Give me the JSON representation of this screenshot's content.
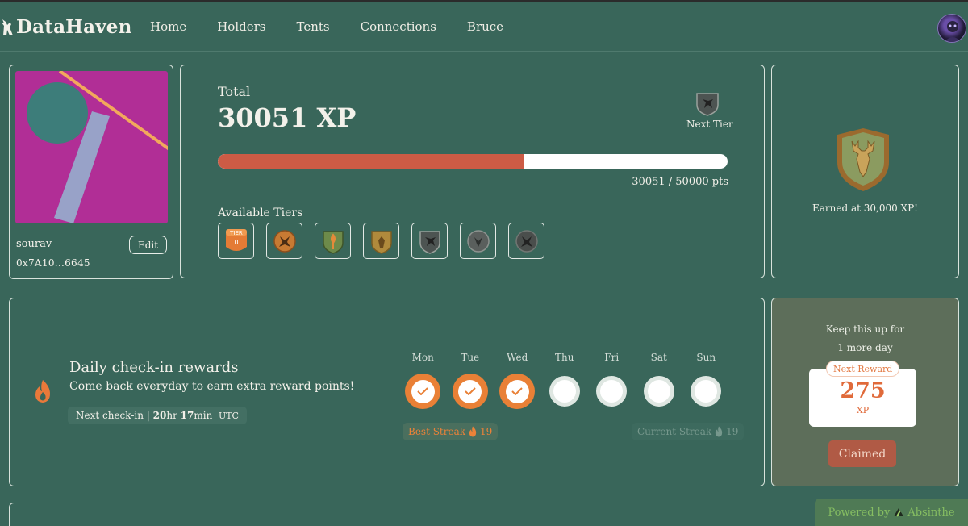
{
  "app": {
    "name": "DataHaven"
  },
  "nav": {
    "items": [
      "Home",
      "Holders",
      "Tents",
      "Connections",
      "Bruce"
    ]
  },
  "profile": {
    "username": "sourav",
    "address": "0x7A10...6645",
    "edit_label": "Edit"
  },
  "xp": {
    "total_label": "Total",
    "total_value": "30051 XP",
    "next_tier_label": "Next Tier",
    "progress_text": "30051 / 50000 pts",
    "progress_fraction": 0.601,
    "tiers_label": "Available Tiers",
    "tier0_badge_line1": "TIER",
    "tier0_badge_line2": "0"
  },
  "earned": {
    "text": "Earned at 30,000 XP!"
  },
  "checkin": {
    "title": "Daily check-in rewards",
    "subtitle": "Come back everyday to earn extra reward points!",
    "next_label": "Next check-in |",
    "hours": "20",
    "hours_unit": "hr",
    "minutes": "17",
    "minutes_unit": "min",
    "tz": "UTC",
    "days": [
      {
        "name": "Mon",
        "done": true
      },
      {
        "name": "Tue",
        "done": true
      },
      {
        "name": "Wed",
        "done": true
      },
      {
        "name": "Thu",
        "done": false
      },
      {
        "name": "Fri",
        "done": false
      },
      {
        "name": "Sat",
        "done": false
      },
      {
        "name": "Sun",
        "done": false
      }
    ],
    "best_streak_label": "Best Streak",
    "best_streak_value": "19",
    "current_streak_label": "Current Streak",
    "current_streak_value": "19"
  },
  "reward": {
    "keep_line1": "Keep this up for",
    "keep_line2": "1 more day",
    "badge": "Next Reward",
    "value": "275",
    "unit": "XP",
    "button": "Claimed"
  },
  "footer": {
    "powered_by": "Powered by",
    "brand": "Absinthe"
  },
  "colors": {
    "background": "#39665a",
    "accent": "#e98036",
    "progress": "#cc5b45"
  }
}
